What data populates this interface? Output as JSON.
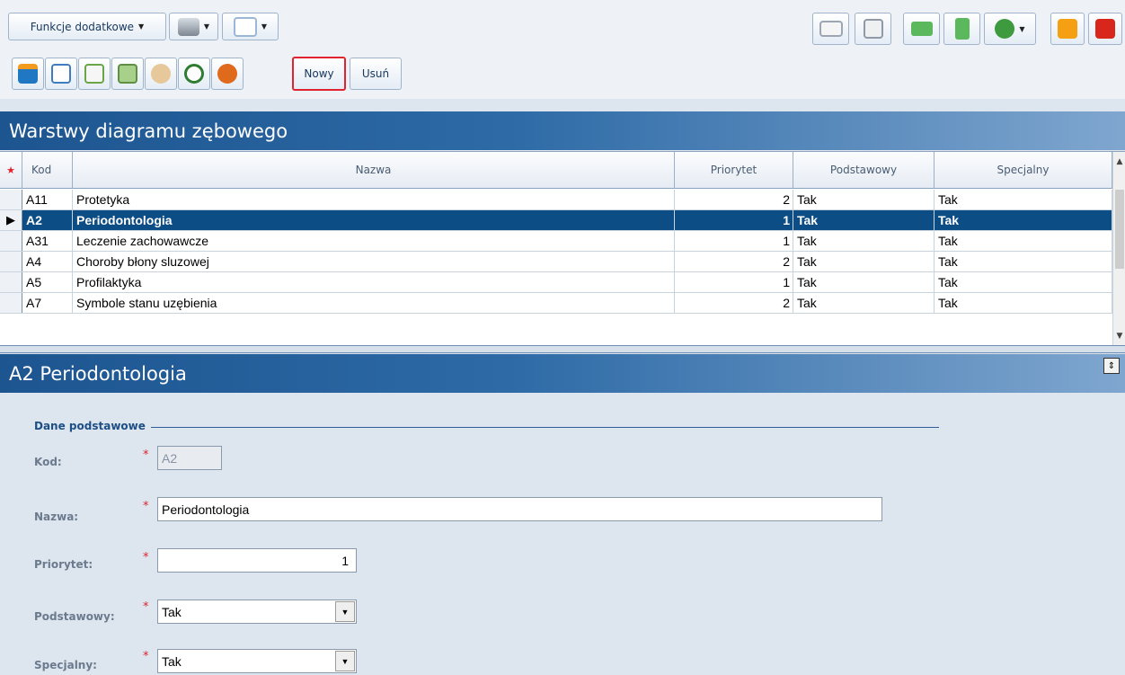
{
  "toolbar": {
    "functions_label": "Funkcje dodatkowe",
    "new_label": "Nowy",
    "delete_label": "Usuń"
  },
  "grid": {
    "title": "Warstwy diagramu zębowego",
    "columns": {
      "kod": "Kod",
      "nazwa": "Nazwa",
      "priorytet": "Priorytet",
      "podstawowy": "Podstawowy",
      "specjalny": "Specjalny"
    },
    "rows": [
      {
        "kod": "A11",
        "nazwa": "Protetyka",
        "priorytet": "2",
        "podstawowy": "Tak",
        "specjalny": "Tak"
      },
      {
        "kod": "A2",
        "nazwa": "Periodontologia",
        "priorytet": "1",
        "podstawowy": "Tak",
        "specjalny": "Tak"
      },
      {
        "kod": "A31",
        "nazwa": "Leczenie zachowawcze",
        "priorytet": "1",
        "podstawowy": "Tak",
        "specjalny": "Tak"
      },
      {
        "kod": "A4",
        "nazwa": "Choroby błony sluzowej",
        "priorytet": "2",
        "podstawowy": "Tak",
        "specjalny": "Tak"
      },
      {
        "kod": "A5",
        "nazwa": "Profilaktyka",
        "priorytet": "1",
        "podstawowy": "Tak",
        "specjalny": "Tak"
      },
      {
        "kod": "A7",
        "nazwa": "Symbole stanu uzębienia",
        "priorytet": "2",
        "podstawowy": "Tak",
        "specjalny": "Tak"
      }
    ],
    "selected_index": 1
  },
  "detail": {
    "title": "A2 Periodontologia",
    "group_label": "Dane podstawowe",
    "fields": {
      "kod": {
        "label": "Kod:",
        "value": "A2"
      },
      "nazwa": {
        "label": "Nazwa:",
        "value": "Periodontologia"
      },
      "priorytet": {
        "label": "Priorytet:",
        "value": "1"
      },
      "podstawowy": {
        "label": "Podstawowy:",
        "value": "Tak"
      },
      "specjalny": {
        "label": "Specjalny:",
        "value": "Tak"
      }
    },
    "required_mark": "*"
  },
  "colors": {
    "header_blue": "#1d5590",
    "selected_row": "#0d4d86",
    "highlight_red": "#e0232f"
  }
}
